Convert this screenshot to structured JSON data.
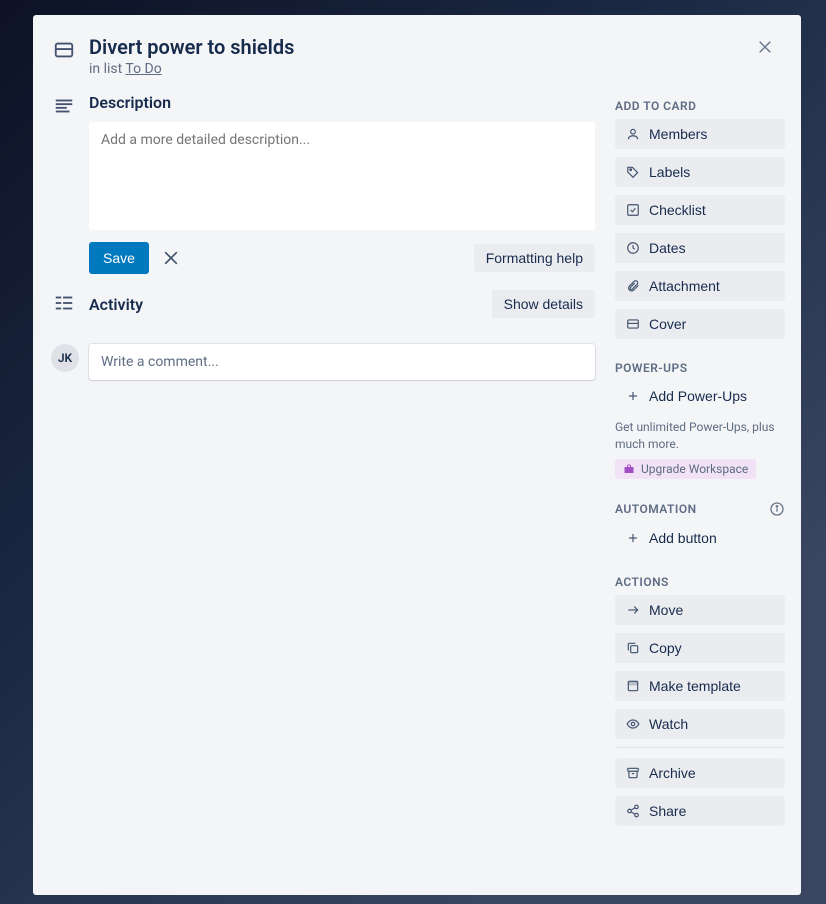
{
  "card": {
    "title": "Divert power to shields",
    "in_list_prefix": "in list ",
    "list_name": "To Do"
  },
  "description": {
    "heading": "Description",
    "placeholder": "Add a more detailed description...",
    "save_label": "Save",
    "formatting_help_label": "Formatting help"
  },
  "activity": {
    "heading": "Activity",
    "show_details_label": "Show details",
    "avatar_initials": "JK",
    "comment_placeholder": "Write a comment..."
  },
  "side": {
    "add_to_card": {
      "heading": "ADD TO CARD",
      "items": [
        {
          "label": "Members",
          "icon": "user"
        },
        {
          "label": "Labels",
          "icon": "tag"
        },
        {
          "label": "Checklist",
          "icon": "check-square"
        },
        {
          "label": "Dates",
          "icon": "clock"
        },
        {
          "label": "Attachment",
          "icon": "paperclip"
        },
        {
          "label": "Cover",
          "icon": "card"
        }
      ]
    },
    "powerups": {
      "heading": "POWER-UPS",
      "add_label": "Add Power-Ups",
      "note": "Get unlimited Power-Ups, plus much more.",
      "upgrade_label": "Upgrade Workspace"
    },
    "automation": {
      "heading": "AUTOMATION",
      "add_label": "Add button"
    },
    "actions": {
      "heading": "ACTIONS",
      "items": [
        {
          "label": "Move",
          "icon": "arrow-right"
        },
        {
          "label": "Copy",
          "icon": "copy"
        },
        {
          "label": "Make template",
          "icon": "template"
        },
        {
          "label": "Watch",
          "icon": "eye"
        }
      ],
      "archive_label": "Archive",
      "share_label": "Share"
    }
  }
}
